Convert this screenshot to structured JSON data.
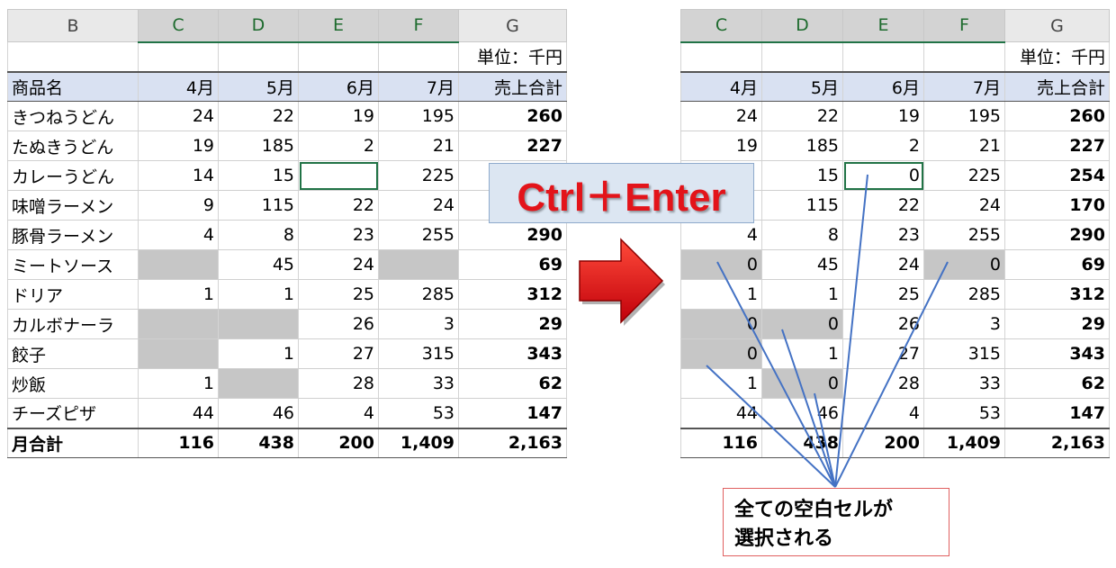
{
  "left": {
    "col_headers": [
      "B",
      "C",
      "D",
      "E",
      "F",
      "G"
    ],
    "unit": "単位：千円",
    "header_row": [
      "商品名",
      "4月",
      "5月",
      "6月",
      "7月",
      "売上合計"
    ],
    "rows": [
      [
        "きつねうどん",
        "24",
        "22",
        "19",
        "195",
        "260"
      ],
      [
        "たぬきうどん",
        "19",
        "185",
        "2",
        "21",
        "227"
      ],
      [
        "カレーうどん",
        "14",
        "15",
        "",
        "225",
        ""
      ],
      [
        "味噌ラーメン",
        "9",
        "115",
        "22",
        "24",
        ""
      ],
      [
        "豚骨ラーメン",
        "4",
        "8",
        "23",
        "255",
        "290"
      ],
      [
        "ミートソース",
        "",
        "45",
        "24",
        "",
        "69"
      ],
      [
        "ドリア",
        "1",
        "1",
        "25",
        "285",
        "312"
      ],
      [
        "カルボナーラ",
        "",
        "",
        "26",
        "3",
        "29"
      ],
      [
        "餃子",
        "",
        "1",
        "27",
        "315",
        "343"
      ],
      [
        "炒飯",
        "1",
        "",
        "28",
        "33",
        "62"
      ],
      [
        "チーズピザ",
        "44",
        "46",
        "4",
        "53",
        "147"
      ]
    ],
    "total_row": [
      "月合計",
      "116",
      "438",
      "200",
      "1,409",
      "2,163"
    ]
  },
  "right": {
    "col_headers": [
      "C",
      "D",
      "E",
      "F",
      "G"
    ],
    "unit": "単位：千円",
    "header_row": [
      "4月",
      "5月",
      "6月",
      "7月",
      "売上合計"
    ],
    "rows": [
      [
        "24",
        "22",
        "19",
        "195",
        "260"
      ],
      [
        "19",
        "185",
        "2",
        "21",
        "227"
      ],
      [
        "",
        "15",
        "0",
        "225",
        "254"
      ],
      [
        "",
        "115",
        "22",
        "24",
        "170"
      ],
      [
        "4",
        "8",
        "23",
        "255",
        "290"
      ],
      [
        "0",
        "45",
        "24",
        "0",
        "69"
      ],
      [
        "1",
        "1",
        "25",
        "285",
        "312"
      ],
      [
        "0",
        "0",
        "26",
        "3",
        "29"
      ],
      [
        "0",
        "1",
        "27",
        "315",
        "343"
      ],
      [
        "1",
        "0",
        "28",
        "33",
        "62"
      ],
      [
        "44",
        "46",
        "4",
        "53",
        "147"
      ]
    ],
    "total_row": [
      "116",
      "438",
      "200",
      "1,409",
      "2,163"
    ]
  },
  "overlay": {
    "shortcut": "Ctrl＋Enter",
    "callout_line1": "全ての空白セルが",
    "callout_line2": "選択される"
  },
  "colors": {
    "shortcut_text": "#e3141a",
    "arrow_fill": "#e8101a",
    "callout_lines": "#4472c4",
    "blank_cell": "#c6c6c6",
    "header_fill": "#d9e1f2"
  }
}
